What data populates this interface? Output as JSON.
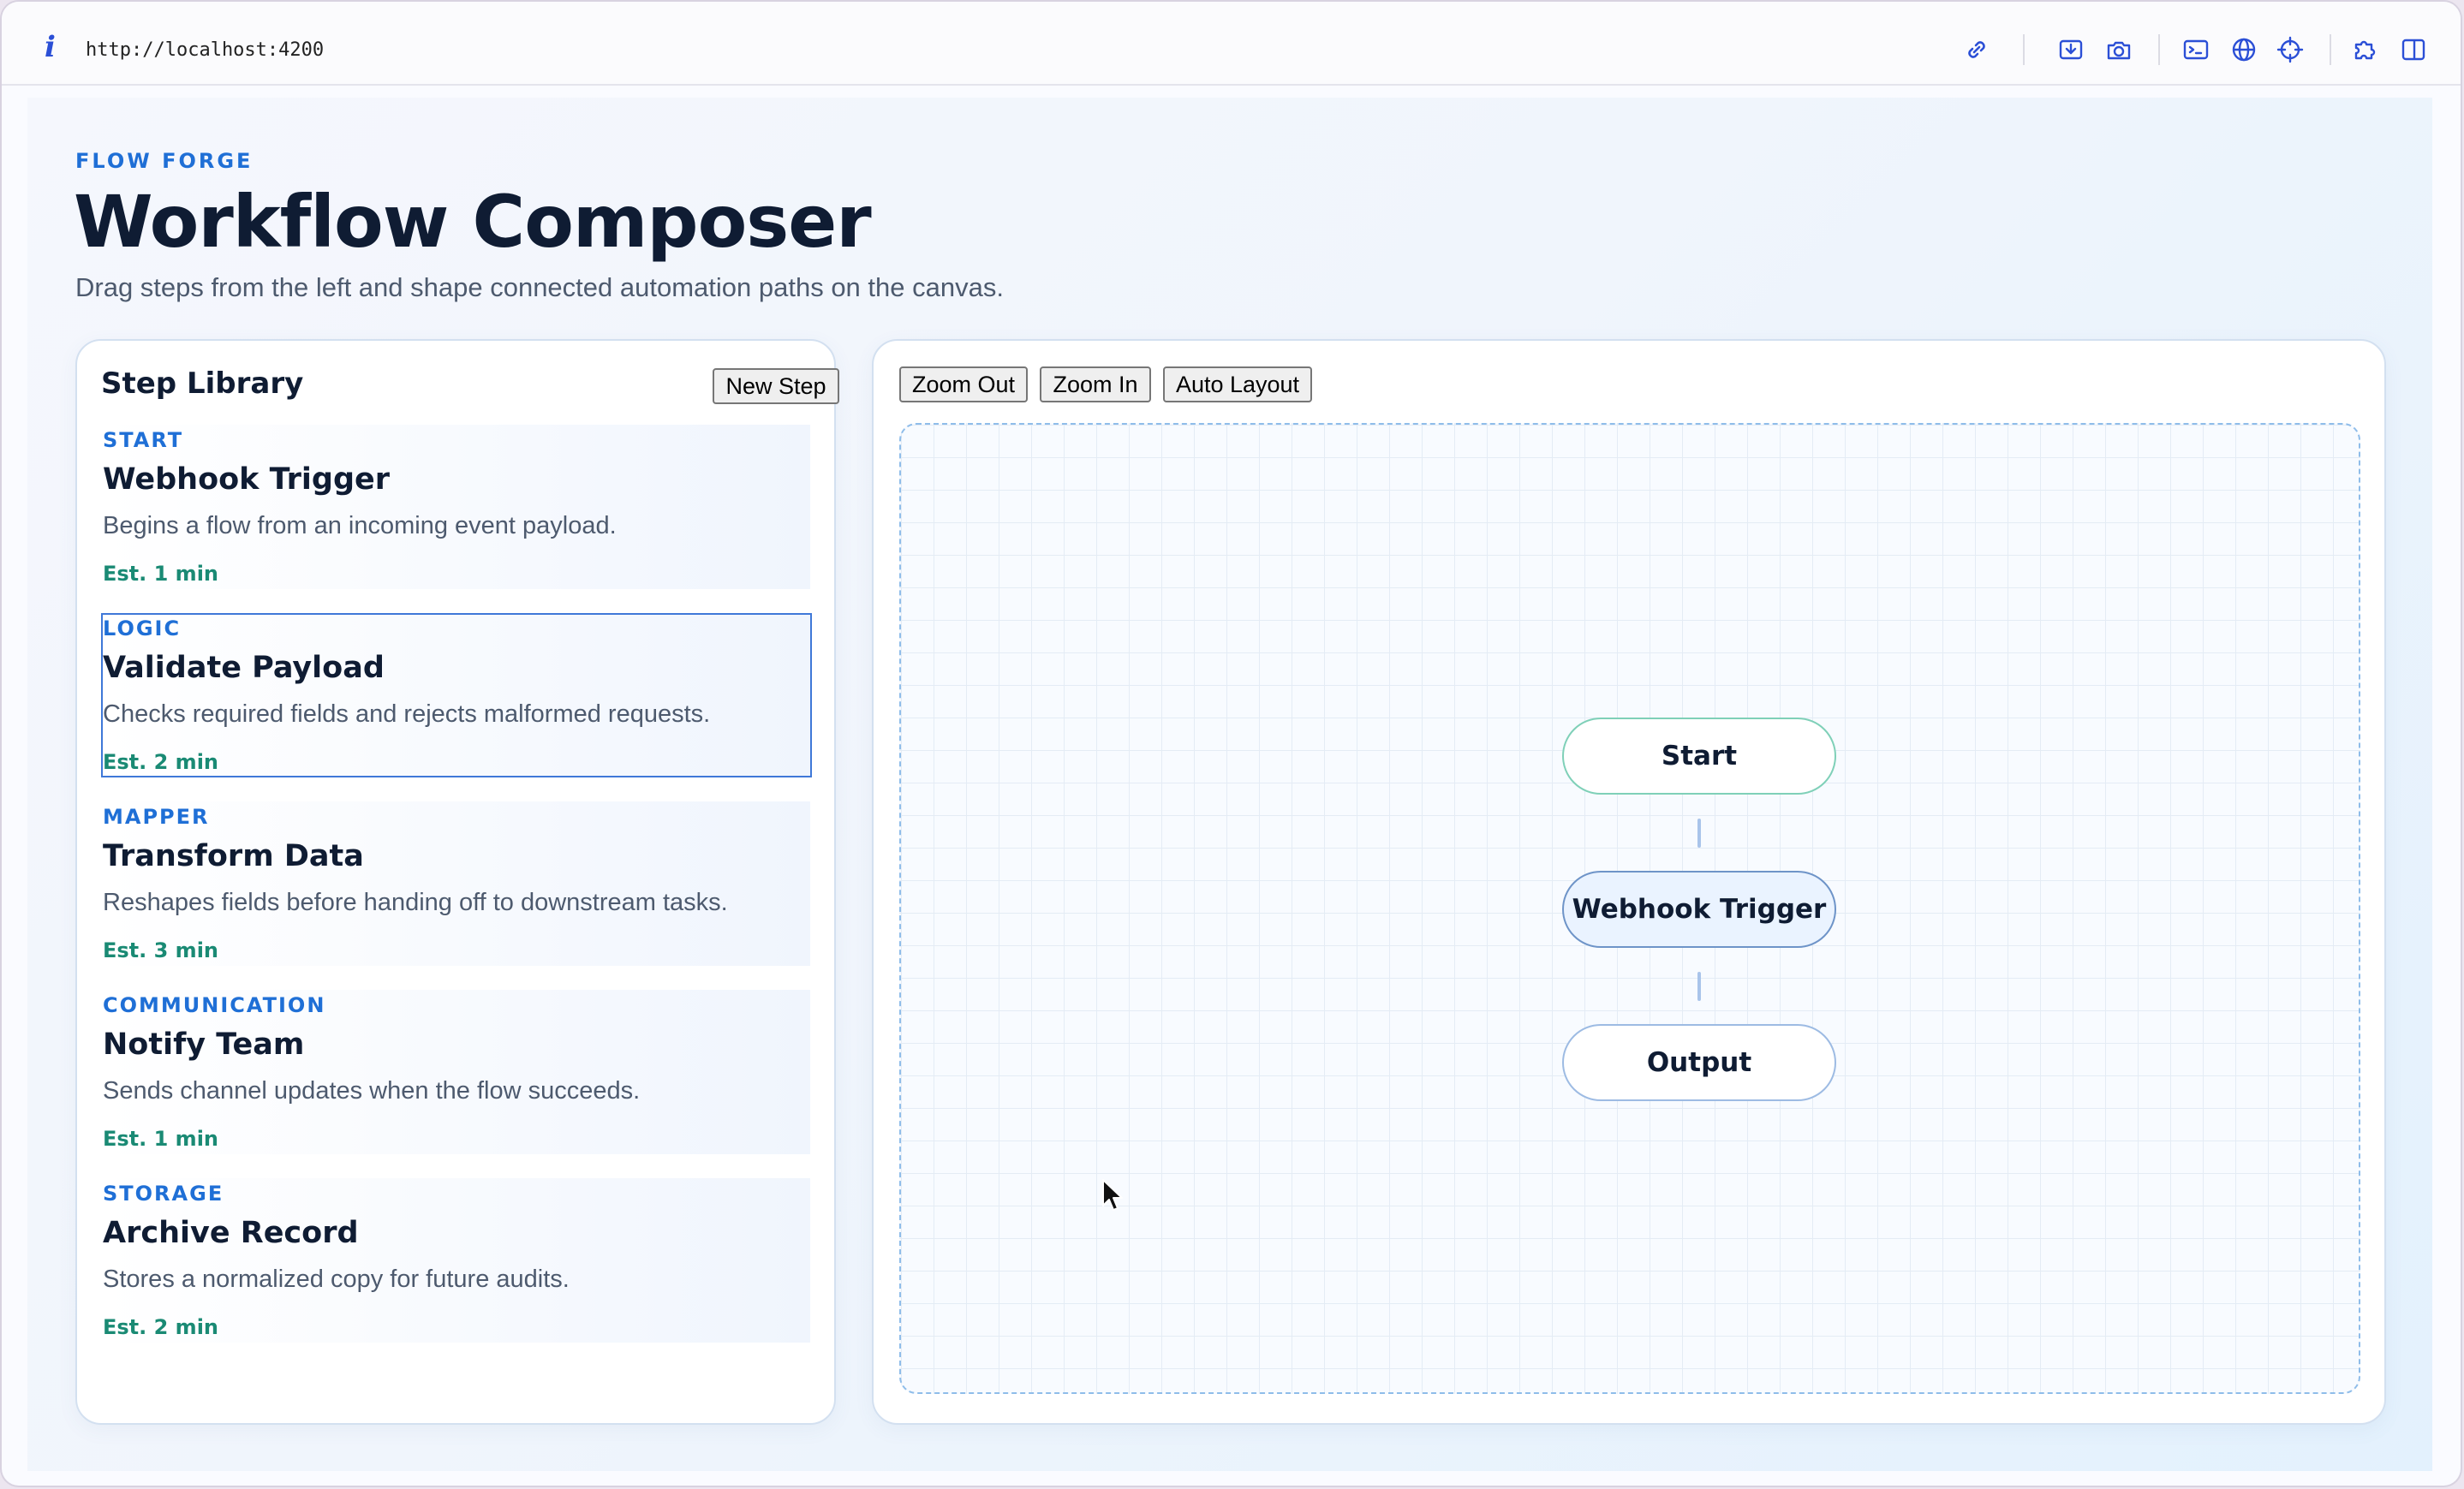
{
  "browser": {
    "info_icon": "i",
    "url": "http://localhost:4200",
    "toolbar_icons": [
      "link-icon",
      "screenshot-area-icon",
      "camera-icon",
      "terminal-icon",
      "globe-icon",
      "crosshair-icon",
      "extensions-icon",
      "split-view-icon"
    ]
  },
  "header": {
    "brand": "FLOW FORGE",
    "title": "Workflow Composer",
    "subtitle": "Drag steps from the left and shape connected automation paths on the canvas."
  },
  "library": {
    "title": "Step Library",
    "new_step_label": "New Step",
    "steps": [
      {
        "category": "START",
        "name": "Webhook Trigger",
        "description": "Begins a flow from an incoming event payload.",
        "estimate": "Est. 1 min",
        "selected": false
      },
      {
        "category": "LOGIC",
        "name": "Validate Payload",
        "description": "Checks required fields and rejects malformed requests.",
        "estimate": "Est. 2 min",
        "selected": true
      },
      {
        "category": "MAPPER",
        "name": "Transform Data",
        "description": "Reshapes fields before handing off to downstream tasks.",
        "estimate": "Est. 3 min",
        "selected": false
      },
      {
        "category": "COMMUNICATION",
        "name": "Notify Team",
        "description": "Sends channel updates when the flow succeeds.",
        "estimate": "Est. 1 min",
        "selected": false
      },
      {
        "category": "STORAGE",
        "name": "Archive Record",
        "description": "Stores a normalized copy for future audits.",
        "estimate": "Est. 2 min",
        "selected": false
      }
    ]
  },
  "canvas": {
    "zoom_out_label": "Zoom Out",
    "zoom_in_label": "Zoom In",
    "auto_layout_label": "Auto Layout",
    "nodes": [
      {
        "label": "Start"
      },
      {
        "label": "Webhook Trigger"
      },
      {
        "label": "Output"
      }
    ]
  },
  "colors": {
    "accent": "#1f6fd6",
    "estimate": "#1a8a74",
    "selected_border": "#3f78d8",
    "heading": "#0f1c33"
  }
}
